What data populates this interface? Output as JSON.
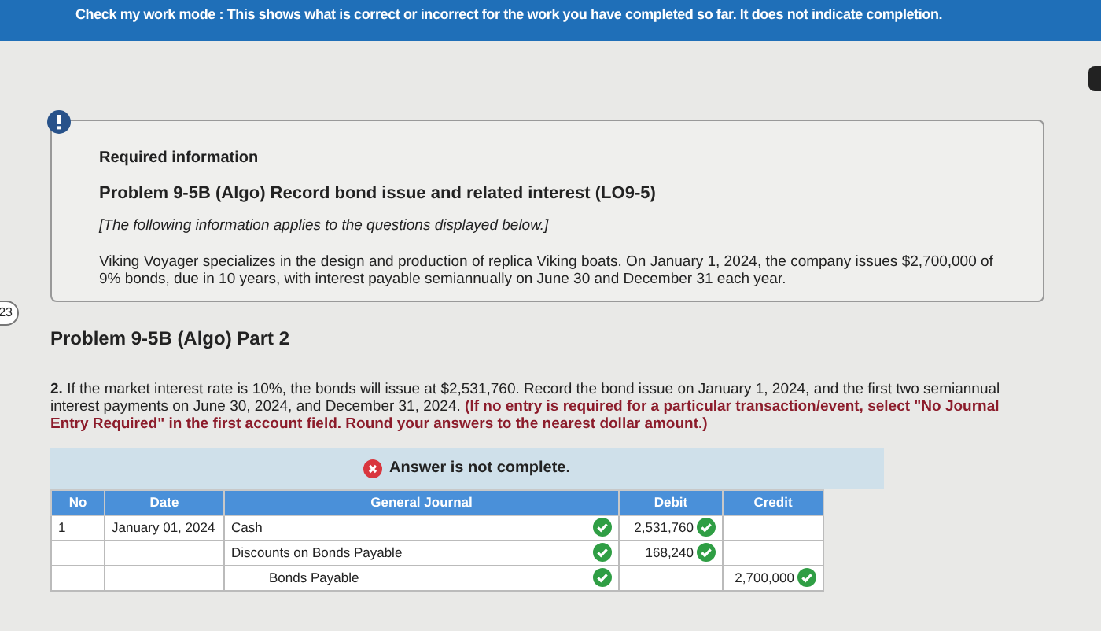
{
  "banner": {
    "label": "Check my work mode :",
    "text": "This shows what is correct or incorrect for the work you have completed so far. It does not indicate completion."
  },
  "side_badge": "23",
  "info": {
    "heading": "Required information",
    "title": "Problem 9-5B (Algo) Record bond issue and related interest (LO9-5)",
    "note": "[The following information applies to the questions displayed below.]",
    "body": "Viking Voyager specializes in the design and production of replica Viking boats. On January 1, 2024, the company issues $2,700,000 of 9% bonds, due in 10 years, with interest payable semiannually on June 30 and December 31 each year."
  },
  "part_title": "Problem 9-5B (Algo) Part 2",
  "question": {
    "number": "2.",
    "text": "If the market interest rate is 10%, the bonds will issue at $2,531,760. Record the bond issue on January 1, 2024, and the first two semiannual interest payments on June 30, 2024, and December 31, 2024.",
    "instruction": "(If no entry is required for a particular transaction/event, select \"No Journal Entry Required\" in the first account field. Round your answers to the nearest dollar amount.)"
  },
  "answer_status": {
    "complete": false,
    "text": "Answer is not complete."
  },
  "table": {
    "columns": [
      "No",
      "Date",
      "General Journal",
      "Debit",
      "Credit"
    ],
    "rows": [
      {
        "no": "1",
        "date": "January 01, 2024",
        "account": "Cash",
        "account_correct": true,
        "debit": "2,531,760",
        "debit_correct": true
      },
      {
        "account": "Discounts on Bonds Payable",
        "account_correct": true,
        "debit": "168,240",
        "debit_correct": true
      },
      {
        "account": "Bonds Payable",
        "account_correct": true,
        "credit": "2,700,000",
        "credit_correct": true
      }
    ]
  }
}
